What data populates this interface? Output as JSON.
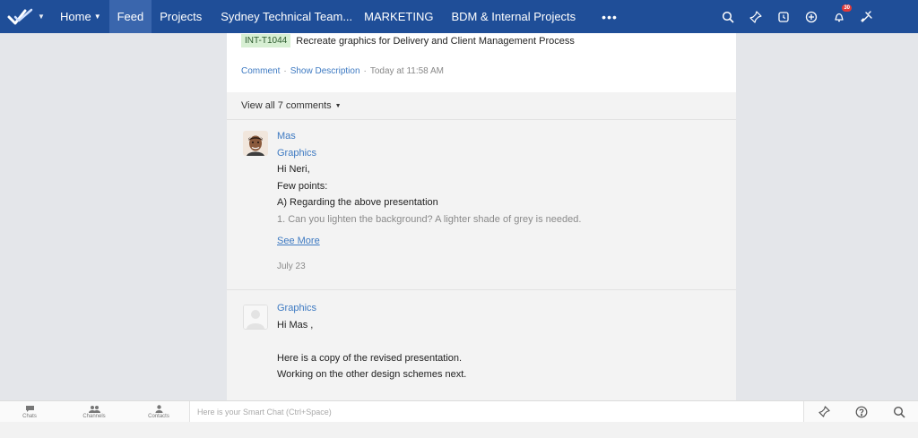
{
  "topbar": {
    "nav": [
      {
        "label": "Home",
        "caret": true,
        "active": false
      },
      {
        "label": "Feed",
        "caret": false,
        "active": true
      },
      {
        "label": "Projects",
        "caret": false,
        "active": false
      },
      {
        "label": "Sydney Technical Team...",
        "caret": false,
        "active": false
      },
      {
        "label": "MARKETING",
        "caret": false,
        "active": false
      },
      {
        "label": "BDM & Internal Projects",
        "caret": false,
        "active": false
      }
    ],
    "more_label": "•••",
    "notification_count": "30",
    "colors": {
      "bar": "#1f4e98",
      "active": "#3a66ad"
    },
    "right_icons": [
      "search-icon",
      "pin-icon",
      "timer-icon",
      "add-icon",
      "notification-bell-icon",
      "tools-icon"
    ]
  },
  "post": {
    "task_id": "INT-T1044",
    "task_title": "Recreate graphics for Delivery and Client Management Process",
    "comment_link": "Comment",
    "separator": "·",
    "show_description": "Show Description",
    "time": "Today at 11:58 AM"
  },
  "view_all": {
    "label": "View all 7 comments"
  },
  "comments": [
    {
      "author": "Mas",
      "group": "Graphics",
      "lines": [
        "Hi Neri,",
        "Few points:",
        "A) Regarding the above presentation",
        "1. Can you lighten the background? A lighter shade of grey is needed."
      ],
      "see_more": "See More",
      "date": "July 23"
    },
    {
      "group": "Graphics",
      "lines": [
        "Hi Mas ,",
        "",
        "Here is a copy of the revised presentation.",
        "Working on the other design schemes next."
      ]
    }
  ],
  "bottombar": {
    "tabs": [
      {
        "label": "Chats",
        "icon": "chat-icon"
      },
      {
        "label": "Channels",
        "icon": "channels-icon"
      },
      {
        "label": "Contacts",
        "icon": "contacts-icon"
      }
    ],
    "smart_chat_placeholder": "Here is your Smart Chat (Ctrl+Space)",
    "right_icons": [
      "pin-icon",
      "help-icon",
      "search-icon"
    ]
  }
}
